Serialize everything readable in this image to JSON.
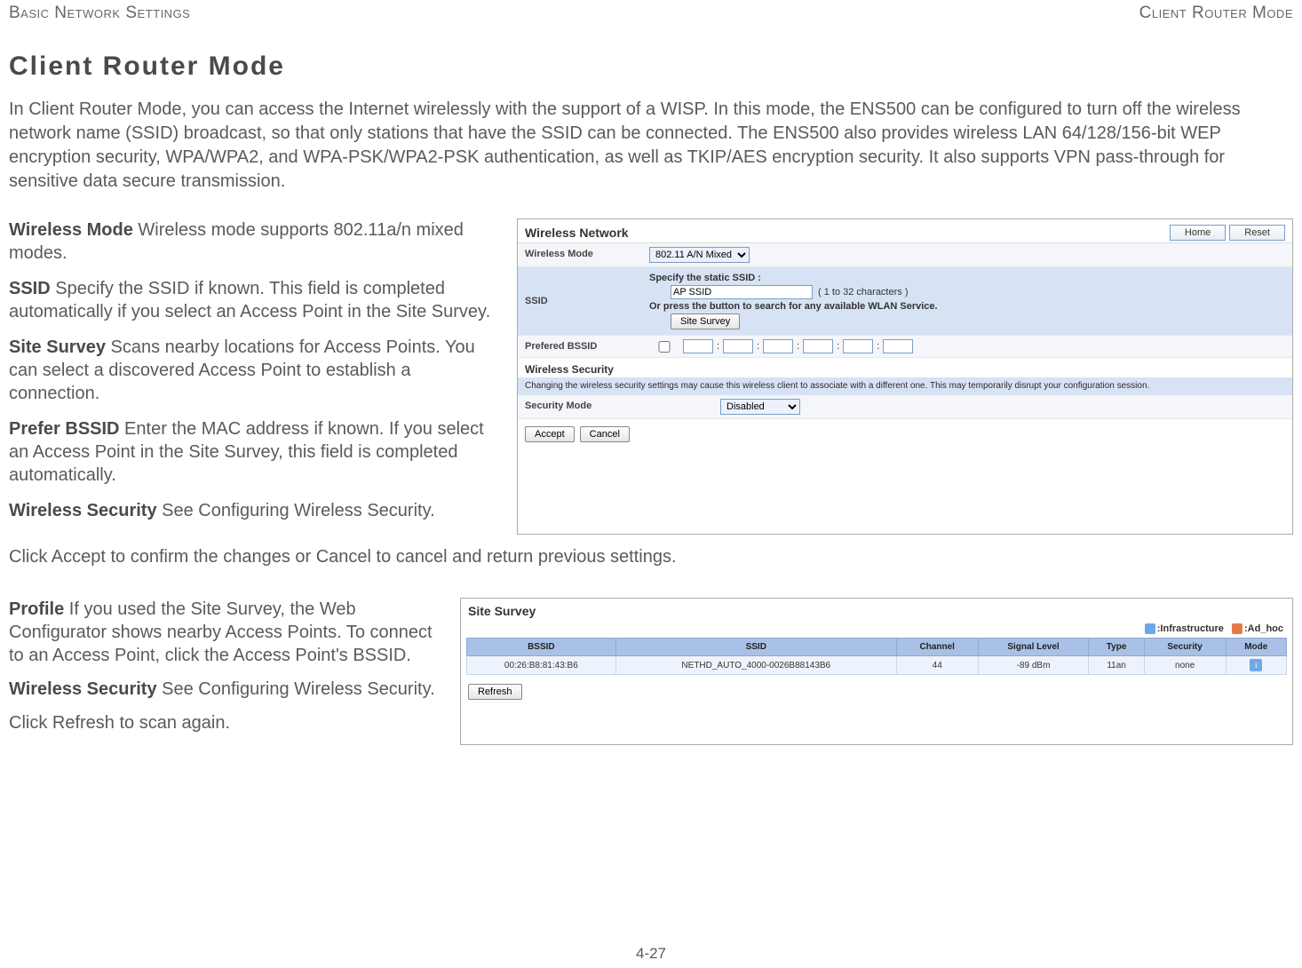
{
  "header": {
    "left": "Basic Network Settings",
    "right": "Client Router Mode"
  },
  "title": "Client Router Mode",
  "intro": "In Client Router Mode, you can access the Internet wirelessly with the support of a WISP. In this mode, the ENS500 can be configured to turn off the wireless network name (SSID) broadcast, so that only stations that have the SSID can be connected. The ENS500 also provides wireless LAN 64/128/156-bit WEP encryption security, WPA/WPA2, and WPA-PSK/WPA2-PSK authentication, as well as TKIP/AES encryption security. It also supports VPN pass-through for sensitive data secure transmission.",
  "defs": {
    "wireless_mode": {
      "term": "Wireless Mode",
      "text": "  Wireless mode supports 802.11a/n mixed modes."
    },
    "ssid": {
      "term": "SSID",
      "text": "  Specify the SSID if known. This field is completed automatically if you select an Access Point in the Site Survey."
    },
    "site_survey": {
      "term": "Site Survey",
      "text": "  Scans nearby locations for Access Points. You can select a discovered Access Point to establish a connection."
    },
    "prefer_bssid": {
      "term": "Prefer BSSID",
      "text": "  Enter the MAC address if known. If you select an Access Point in the Site Survey, this field is completed automatically."
    },
    "wireless_security": {
      "term": "Wireless Security",
      "text": "  See Configuring Wireless Security."
    }
  },
  "accept_line": "Click Accept  to confirm the changes or Cancel  to cancel and return previous settings.",
  "panel1": {
    "title": "Wireless Network",
    "home_btn": "Home",
    "reset_btn": "Reset",
    "wireless_mode_label": "Wireless Mode",
    "wireless_mode_value": "802.11 A/N Mixed",
    "ssid_label": "SSID",
    "ssid_specify": "Specify the static SSID  :",
    "ssid_value": "AP SSID",
    "ssid_hint": "( 1 to 32 characters )",
    "ssid_or": "Or press the button to search for any available WLAN Service.",
    "site_survey_btn": "Site Survey",
    "prefered_bssid_label": "Prefered BSSID",
    "wireless_security_header": "Wireless Security",
    "warning": "Changing the wireless security settings may cause this wireless client to associate with a different one. This may temporarily disrupt your configuration session.",
    "security_mode_label": "Security Mode",
    "security_mode_value": "Disabled",
    "accept_btn": "Accept",
    "cancel_btn": "Cancel"
  },
  "defs2": {
    "profile": {
      "term": "Profile",
      "text": "  If you used the Site Survey, the Web Configurator shows nearby Access Points. To connect to an Access Point, click the Access Point's BSSID."
    },
    "wireless_security": {
      "term": "Wireless Security",
      "text": "  See Configuring Wireless Security."
    },
    "refresh": "Click Refresh  to scan again."
  },
  "panel2": {
    "title": "Site Survey",
    "legend_infra": ":Infrastructure",
    "legend_adhoc": ":Ad_hoc",
    "cols": {
      "bssid": "BSSID",
      "ssid": "SSID",
      "channel": "Channel",
      "signal": "Signal Level",
      "type": "Type",
      "security": "Security",
      "mode": "Mode"
    },
    "row": {
      "bssid": "00:26:B8:81:43:B6",
      "ssid": "NETHD_AUTO_4000-0026B88143B6",
      "channel": "44",
      "signal": "-89 dBm",
      "type": "11an",
      "security": "none",
      "mode": "i"
    },
    "refresh_btn": "Refresh"
  },
  "page_num": "4-27"
}
